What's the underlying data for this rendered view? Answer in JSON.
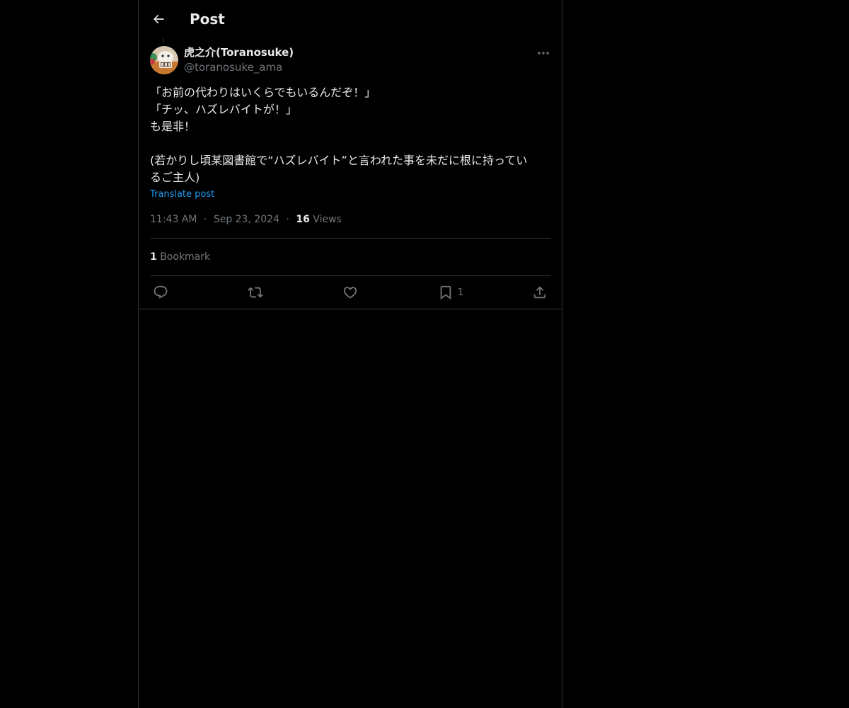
{
  "header": {
    "title": "Post",
    "back_icon": "arrow-left-icon"
  },
  "author": {
    "display_name": "虎之介(Toranosuke)",
    "handle": "@toranosuke_ama",
    "avatar_icon": "avatar-image"
  },
  "post": {
    "lines": [
      "「お前の代わりはいくらでもいるんだぞ！」",
      "「チッ、ハズレバイトが！」",
      "も是非！",
      "",
      "(若かりし頃某図書館で“ハズレバイト”と言われた事を未だに根に持ってい",
      "るご主人)"
    ],
    "translate_label": "Translate post"
  },
  "meta": {
    "time": "11:43 AM",
    "separator": "·",
    "date": "Sep 23, 2024",
    "views_count": "16",
    "views_label": "Views"
  },
  "stats": {
    "bookmark_count": "1",
    "bookmark_label": "Bookmark"
  },
  "actions": {
    "reply_icon": "reply-icon",
    "repost_icon": "repost-icon",
    "like_icon": "heart-icon",
    "bookmark_icon": "bookmark-icon",
    "bookmark_count": "1",
    "share_icon": "share-icon"
  },
  "colors": {
    "background": "#000000",
    "text": "#e7e9ea",
    "secondary": "#71767b",
    "accent": "#1d9bf0",
    "border": "#2f3336"
  }
}
